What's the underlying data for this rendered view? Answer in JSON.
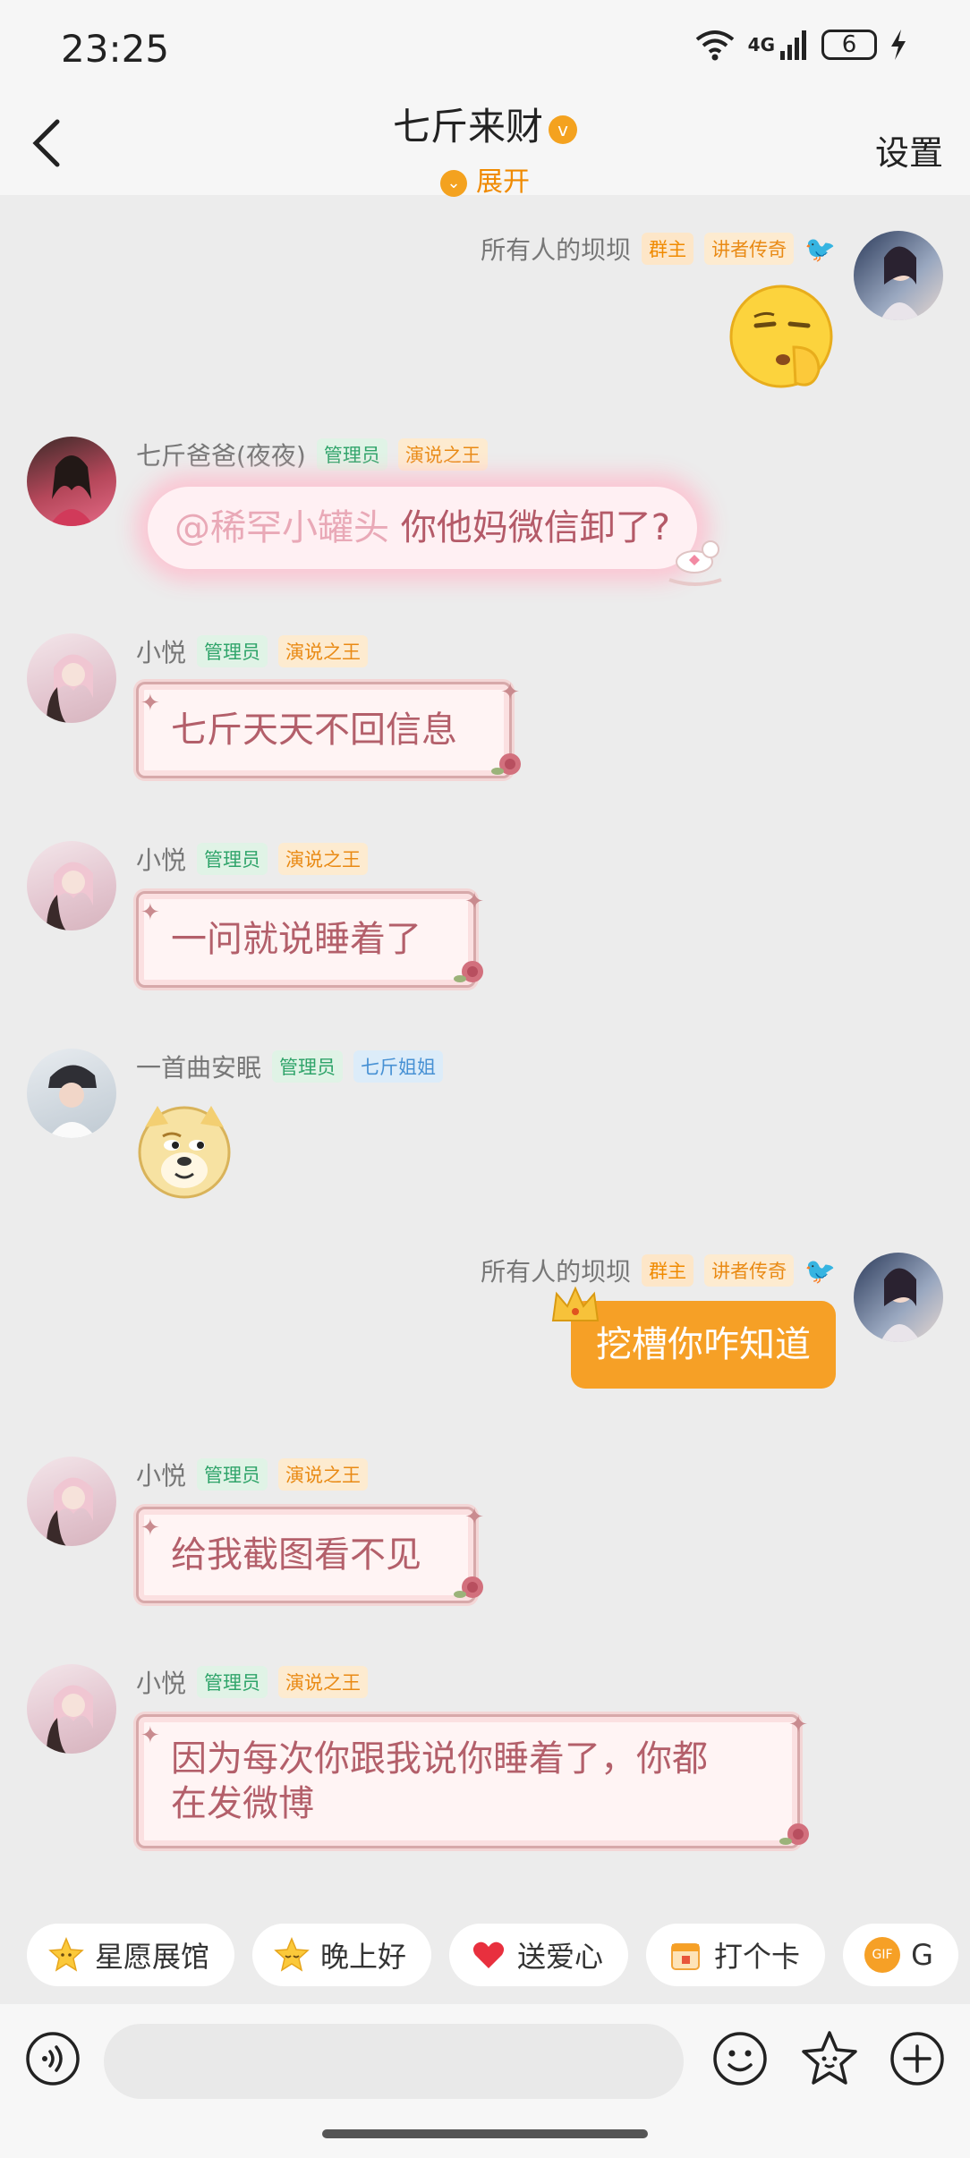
{
  "status_bar": {
    "time": "23:25",
    "network": "4G",
    "battery": "6"
  },
  "header": {
    "title": "七斤来财",
    "expand_label": "展开",
    "settings_label": "设置",
    "verified_mark": "v"
  },
  "messages": [
    {
      "sender": "所有人的坝坝",
      "badges": [
        "群主",
        "讲者传奇"
      ],
      "side": "right",
      "type": "emoji"
    },
    {
      "sender": "七斤爸爸(夜夜)",
      "badges": [
        "管理员",
        "演说之王"
      ],
      "side": "left",
      "mention": "@稀罕小罐头",
      "text": "你他妈微信卸了?"
    },
    {
      "sender": "小悦",
      "badges": [
        "管理员",
        "演说之王"
      ],
      "side": "left",
      "text": "七斤天天不回信息"
    },
    {
      "sender": "小悦",
      "badges": [
        "管理员",
        "演说之王"
      ],
      "side": "left",
      "text": "一问就说睡着了"
    },
    {
      "sender": "一首曲安眠",
      "badges": [
        "管理员",
        "七斤姐姐"
      ],
      "side": "left",
      "type": "emoji"
    },
    {
      "sender": "所有人的坝坝",
      "badges": [
        "群主",
        "讲者传奇"
      ],
      "side": "right",
      "text": "挖槽你咋知道"
    },
    {
      "sender": "小悦",
      "badges": [
        "管理员",
        "演说之王"
      ],
      "side": "left",
      "text": "给我截图看不见"
    },
    {
      "sender": "小悦",
      "badges": [
        "管理员",
        "演说之王"
      ],
      "side": "left",
      "text_line1": "因为每次你跟我说你睡着了，你都",
      "text_line2": "在发微博"
    }
  ],
  "quick_replies": [
    {
      "label": "星愿展馆",
      "icon": "star-face-icon"
    },
    {
      "label": "晚上好",
      "icon": "star-sleep-icon"
    },
    {
      "label": "送爱心",
      "icon": "heart-icon"
    },
    {
      "label": "打个卡",
      "icon": "calendar-icon"
    },
    {
      "label": "G",
      "icon": "gif-icon",
      "gif": "GIF"
    }
  ],
  "input": {
    "placeholder": ""
  },
  "colors": {
    "accent": "#f6a026",
    "admin": "#2fa46a",
    "pink_text": "#b35f6a"
  }
}
